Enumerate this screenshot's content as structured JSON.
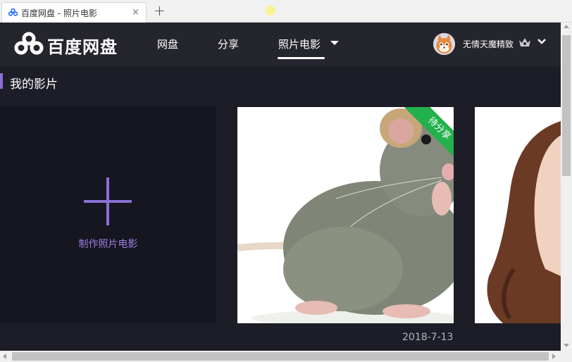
{
  "browser": {
    "tab_title": "百度网盘 - 照片电影",
    "tab_close": "×",
    "new_tab": "+"
  },
  "header": {
    "logo_text": "百度网盘",
    "nav": [
      {
        "label": "网盘",
        "active": false
      },
      {
        "label": "分享",
        "active": false
      },
      {
        "label": "照片电影",
        "active": true
      }
    ],
    "username": "无情天魔精致"
  },
  "section": {
    "title": "我的影片"
  },
  "cards": {
    "create_label": "制作照片电影",
    "movie_ribbon": "待分享",
    "movie_date": "2018-7-13"
  },
  "colors": {
    "header_bg": "#25262d",
    "page_bg": "#1c1d26",
    "accent_purple": "#8b6fd6",
    "ribbon_green": "#22b14c"
  },
  "icons": {
    "favicon": "baidu-cloud-icon",
    "logo": "baidu-cloud-logo-icon",
    "crown": "crown-icon",
    "nav_dropdown": "chevron-down-icon",
    "user_dropdown": "chevron-down-icon",
    "create": "plus-icon"
  }
}
